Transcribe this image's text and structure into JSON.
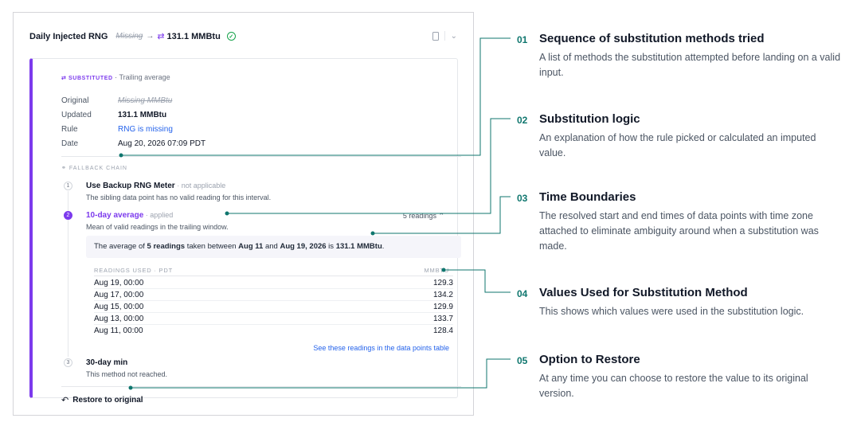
{
  "header": {
    "title": "Daily Injected RNG",
    "original_value": "Missing",
    "arrow": "→",
    "swap_glyph": "⇄",
    "new_value": "131.1 MMBtu",
    "status_icon": "check-circle-icon",
    "collapse_glyph": "⌄"
  },
  "substitution": {
    "tag": "SUBSTITUTED",
    "method": "Trailing average",
    "rows": [
      {
        "label": "Original",
        "value": "Missing MMBtu"
      },
      {
        "label": "Updated",
        "value": "131.1 MMBtu"
      },
      {
        "label": "Rule",
        "value": "RNG is missing"
      },
      {
        "label": "Date",
        "value": "Aug 20, 2026 07:09 PDT"
      }
    ]
  },
  "fallback": {
    "label": "FALLBACK CHAIN",
    "steps": [
      {
        "num": "1",
        "title": "Use Backup RNG Meter",
        "status": "not applicable",
        "desc": "The sibling data point has no valid reading for this interval."
      },
      {
        "num": "2",
        "title": "10-day average",
        "status": "applied",
        "desc": "Mean of valid readings in the trailing window.",
        "toggle": "5 readings ⌃"
      },
      {
        "num": "3",
        "title": "30-day min",
        "desc": "This method not reached."
      }
    ],
    "explanation": {
      "pre": "The average of ",
      "count": "5 readings",
      "mid": " taken between ",
      "start": "Aug 11",
      "and": " and ",
      "end": "Aug 19, 2026",
      "is": " is ",
      "result": "131.1 MMBtu",
      "post": "."
    },
    "table": {
      "col_date": "READINGS USED · PDT",
      "col_value": "MMBTU",
      "rows": [
        {
          "date": "Aug 19, 00:00",
          "value": "129.3"
        },
        {
          "date": "Aug 17, 00:00",
          "value": "134.2"
        },
        {
          "date": "Aug 15, 00:00",
          "value": "129.9"
        },
        {
          "date": "Aug 13, 00:00",
          "value": "133.7"
        },
        {
          "date": "Aug 11, 00:00",
          "value": "128.4"
        }
      ],
      "link": "See these readings in the data points table"
    }
  },
  "restore": {
    "label": "Restore to original",
    "icon": "undo-icon"
  },
  "callouts": [
    {
      "num": "01",
      "title": "Sequence of substitution methods tried",
      "desc": "A list of methods the substitution attempted before landing on a valid input."
    },
    {
      "num": "02",
      "title": "Substitution logic",
      "desc": "An explanation of how the rule picked or calculated an imputed value."
    },
    {
      "num": "03",
      "title": "Time Boundaries",
      "desc": "The resolved start and end times of data points with time zone attached to eliminate ambiguity around when a substitution was made."
    },
    {
      "num": "04",
      "title": "Values Used for Substitution Method",
      "desc": "This shows which values were used in the substitution logic."
    },
    {
      "num": "05",
      "title": "Option to Restore",
      "desc": "At any time you can choose to restore the value to its original version."
    }
  ],
  "colors": {
    "accent": "#7c3aed",
    "teal": "#0f766e",
    "link": "#2563eb"
  }
}
